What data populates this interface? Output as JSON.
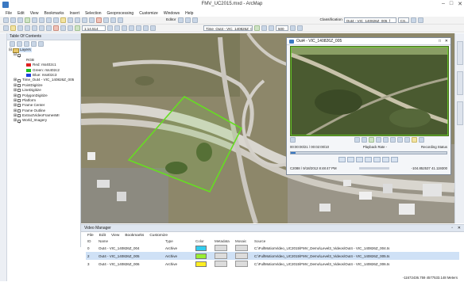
{
  "window": {
    "title": "FMV_UC2015.mxd - ArcMap"
  },
  "menubar": [
    "File",
    "Edit",
    "View",
    "Bookmarks",
    "Insert",
    "Selection",
    "Geoprocessing",
    "Customize",
    "Windows",
    "Help"
  ],
  "toolbar": {
    "scale": "1:14,514",
    "editor_label": "Editor",
    "time_layer": "Time_Out4 - VIC_140826Z_0",
    "step_value": "500",
    "classification_label": "Classification",
    "classification_value": "Out4 - VIC_140826Z_005_f",
    "classification_field": "CS..."
  },
  "toc": {
    "title": "Table Of Contents",
    "root": "Layers",
    "rgb": {
      "label": "RGB",
      "red": "Red:  rss402c1",
      "green": "Green: rss402c2",
      "blue": "Blue:  rss402c3",
      "colors": {
        "red": "#e02020",
        "green": "#20c020",
        "blue": "#2040e0"
      }
    },
    "layers": [
      "Time_Out4 - VIC_140826Z_005",
      "PointDigitize",
      "LineDigitize",
      "PolygonDigitize",
      "Platform",
      "Frame Center",
      "Frame Outline",
      "ExtractVideoFramesMI",
      "World_Imagery"
    ]
  },
  "right_tabs": [
    "Search",
    "Geoprocessing",
    "Catalog",
    "Attribute Table"
  ],
  "video_window": {
    "title": "Out4 - VIC_140826Z_005",
    "timecode": "00:00:00/21 / 00:02:00/10",
    "playback_rate": "Playback Rate -",
    "recording_status": "Recording Status",
    "info_left": "C2088 / 9/18/2012 8:48:47 PM",
    "info_right": "-104.852537 41.119300"
  },
  "video_manager": {
    "title": "Video Manager",
    "menu": [
      "File",
      "Edit",
      "View",
      "Bookmarks",
      "Customize"
    ],
    "columns": [
      "ID",
      "Name",
      "Type",
      "Color",
      "Metadata",
      "Mosaic",
      "Source"
    ],
    "rows": [
      {
        "id": "0",
        "name": "Out4 - VIC_140826Z_004",
        "type": "Archive",
        "color": "#33ccee",
        "source": "C:\\FullMotionVideo_UC2015\\FMV_Demo\\Level3_Videos\\Out4 - VIC_140826Z_004.ts"
      },
      {
        "id": "2",
        "name": "Out4 - VIC_140826Z_005",
        "type": "Archive",
        "color": "#99ee33",
        "source": "C:\\FullMotionVideo_UC2015\\FMV_Demo\\Level3_Videos\\Out4 - VIC_140826Z_005.ts"
      },
      {
        "id": "3",
        "name": "Out4 - VIC_140826Z_006",
        "type": "Archive",
        "color": "#ffee22",
        "source": "C:\\FullMotionVideo_UC2015\\FMV_Demo\\Level3_Videos\\Out4 - VIC_140826Z_006.ts"
      }
    ]
  },
  "status": {
    "coordinates": "-11672436.759  4577533.148 Meters"
  },
  "colors": {
    "footprint": "#66dd22",
    "vm_selected_row": "#cfe1f6"
  }
}
